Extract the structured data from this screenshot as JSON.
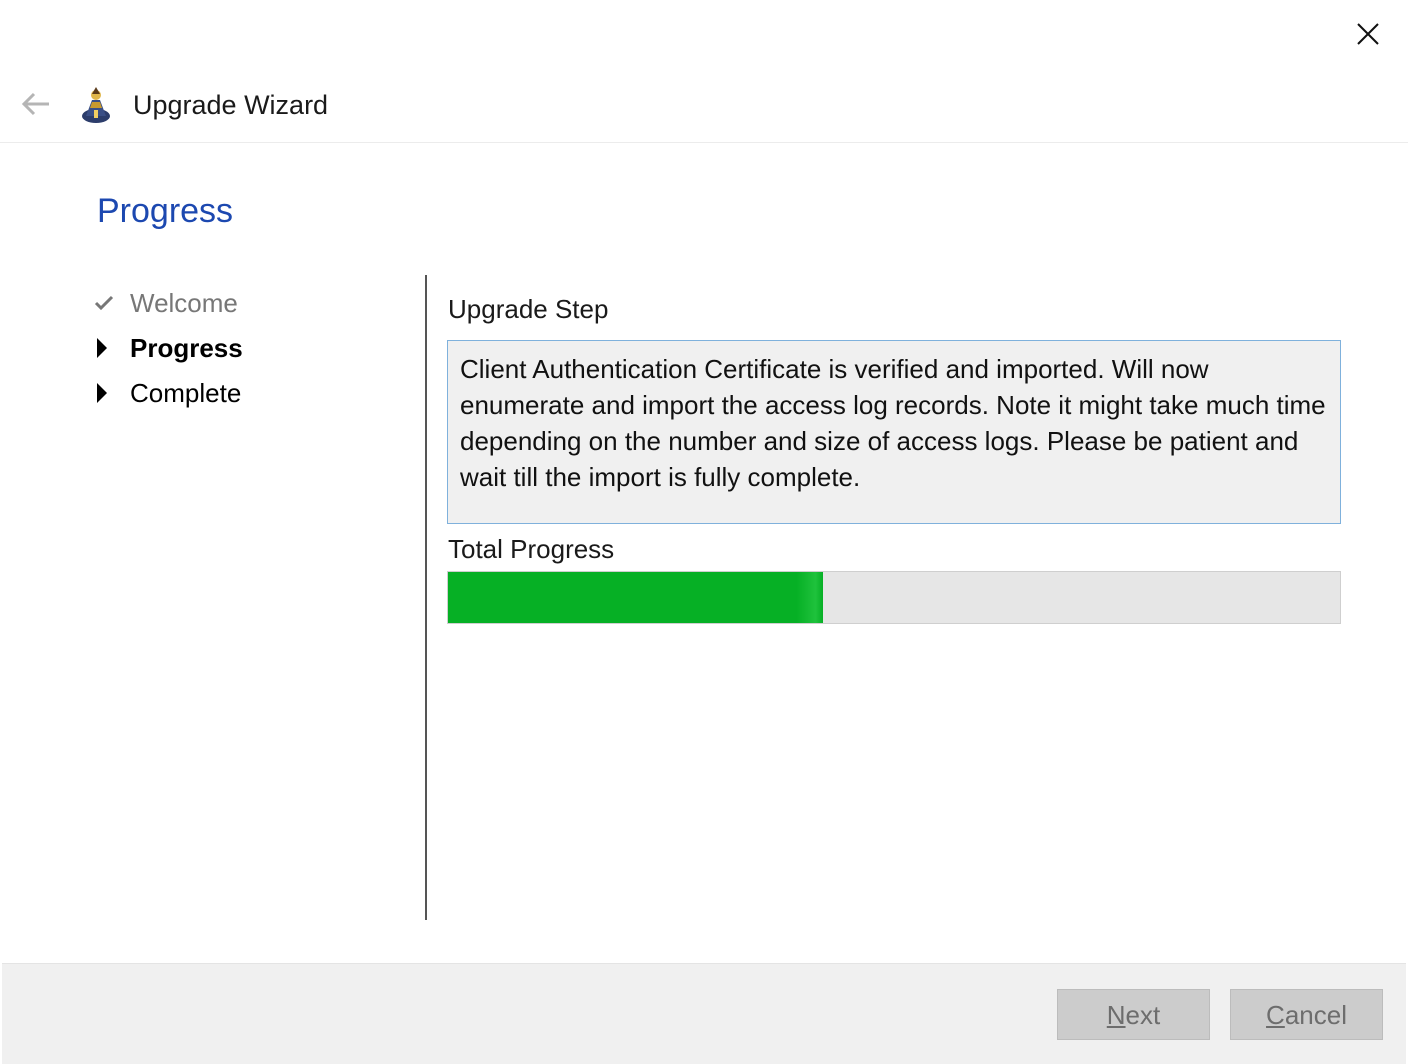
{
  "window": {
    "title": "Upgrade Wizard",
    "close_icon": "close-icon",
    "back_icon": "back-arrow-icon",
    "app_icon": "wizard-app-icon"
  },
  "page": {
    "title": "Progress"
  },
  "steps": [
    {
      "label": "Welcome",
      "state": "done",
      "icon": "checkmark-icon"
    },
    {
      "label": "Progress",
      "state": "active",
      "icon": "triangle-right-icon"
    },
    {
      "label": "Complete",
      "state": "pending",
      "icon": "triangle-right-icon"
    }
  ],
  "upgrade_step": {
    "label": "Upgrade Step",
    "message": "Client Authentication Certificate is verified and imported. Will now enumerate and import the access log records. Note it might take much time depending on the number and size of access logs. Please be patient and wait till the import is fully complete."
  },
  "total_progress": {
    "label": "Total Progress",
    "fraction": 0.42,
    "color": "#06b025"
  },
  "buttons": {
    "next": {
      "label": "Next",
      "access_key": "N",
      "rest": "ext",
      "enabled": false
    },
    "cancel": {
      "label": "Cancel",
      "access_key": "C",
      "rest": "ancel",
      "enabled": false
    }
  },
  "colors": {
    "title_blue": "#1c48b0",
    "box_border": "#7fb1dc",
    "progress_green": "#06b025"
  }
}
